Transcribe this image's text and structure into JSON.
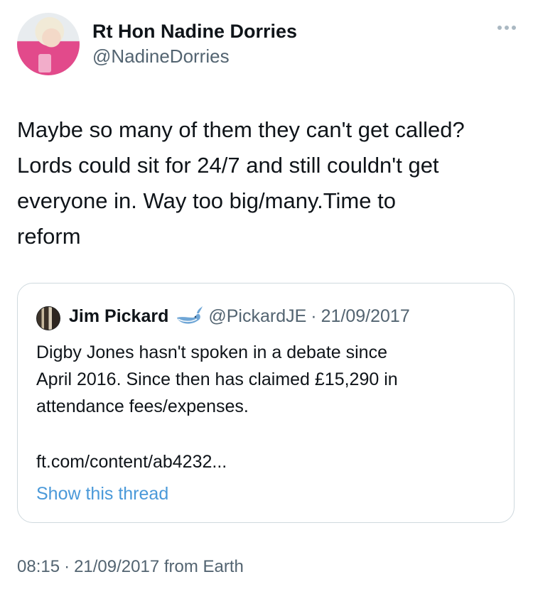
{
  "tweet": {
    "author_name": "Rt Hon Nadine Dorries",
    "author_handle": "@NadineDorries",
    "text": "Maybe so many of them they can't get called?\nLords could sit for 24/7 and still couldn't get\neveryone in. Way too big/many.Time to\nreform",
    "more_icon": "more-horizontal-icon"
  },
  "quote": {
    "author_name": "Jim Pickard",
    "badge_icon": "whale-badge-icon",
    "author_handle": "@PickardJE",
    "separator": "·",
    "date": "21/09/2017",
    "text": "Digby Jones hasn't spoken in a debate since\nApril 2016. Since then has claimed £15,290 in\nattendance fees/expenses.",
    "link": "ft.com/content/ab4232...",
    "show_thread": "Show this thread"
  },
  "footer": {
    "time": "08:15",
    "separator": "·",
    "date_source": "21/09/2017 from Earth"
  },
  "colors": {
    "link_blue": "#4a99d9",
    "secondary_text": "#536471",
    "border": "#cfd9de"
  }
}
